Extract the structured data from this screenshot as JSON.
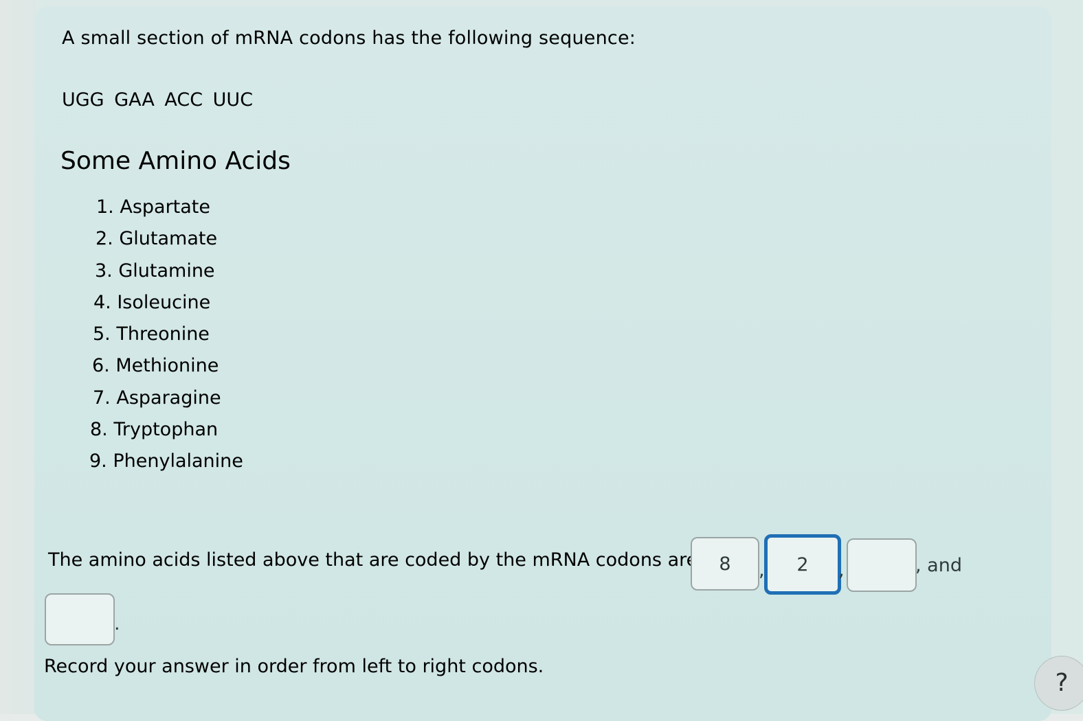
{
  "problem": {
    "prompt": "A small section of mRNA codons has the following sequence:",
    "sequence": "UGG GAA ACC UUC",
    "heading": "Some Amino Acids",
    "amino_acids": [
      "1. Aspartate",
      "2. Glutamate",
      "3. Glutamine",
      "4. Isoleucine",
      "5. Threonine",
      "6. Methionine",
      "7. Asparagine",
      "8. Tryptophan",
      "9. Phenylalanine"
    ],
    "question": "The amino acids listed above that are coded by the mRNA codons are",
    "answers": [
      "8",
      "2",
      "",
      ""
    ],
    "separators": [
      ",",
      ",",
      ", and",
      "."
    ],
    "instruction": "Record your answer in order from left to right codons."
  },
  "help": {
    "label": "?"
  },
  "colors": {
    "panel": "#d3e8e6",
    "text": "#2f3b3a",
    "focus_border": "#1f6fb5"
  }
}
